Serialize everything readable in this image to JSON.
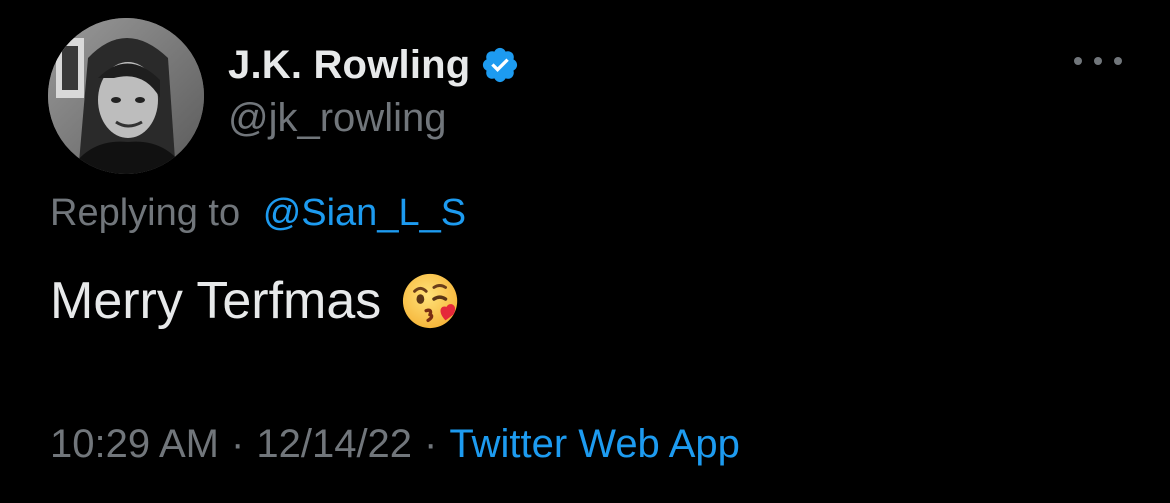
{
  "author": {
    "display_name": "J.K. Rowling",
    "handle": "@jk_rowling",
    "verified": true
  },
  "reply": {
    "prefix": "Replying to",
    "mention": "@Sian_L_S"
  },
  "tweet": {
    "text": "Merry Terfmas",
    "emoji": "kissing-face-blowing-heart"
  },
  "meta": {
    "time": "10:29 AM",
    "separator1": "·",
    "date": "12/14/22",
    "separator2": "·",
    "source": "Twitter Web App"
  },
  "colors": {
    "background": "#000000",
    "primary_text": "#e7e9ea",
    "secondary_text": "#71767b",
    "accent": "#1d9bf0"
  }
}
